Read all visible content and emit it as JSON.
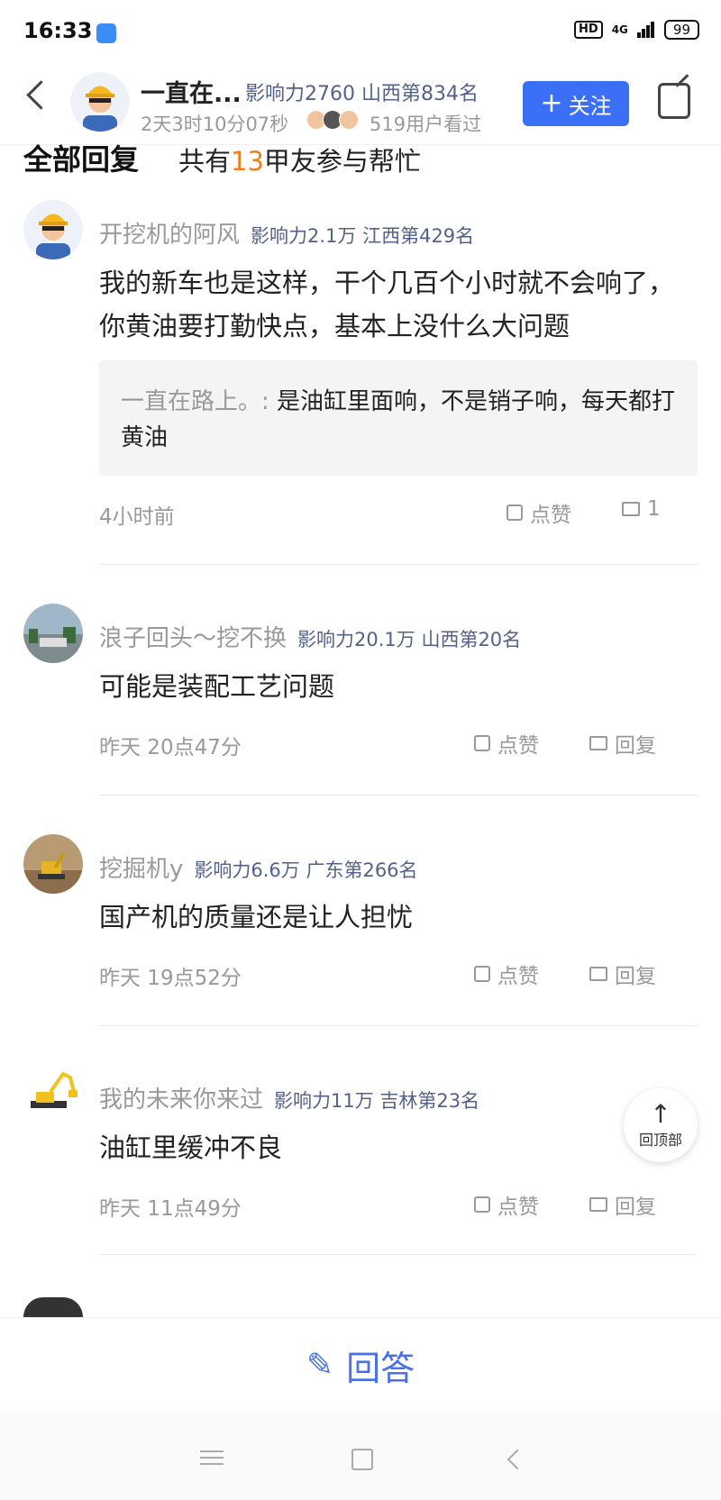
{
  "status_bar": {
    "time": "16:33",
    "hd": "HD",
    "network": "4G",
    "battery": "99"
  },
  "header": {
    "user_name": "一直在...",
    "user_info": "影响力2760 山西第834名",
    "timer": "2天3时10分07秒",
    "viewers": "519用户看过",
    "follow_label": "关注",
    "follow_color": "#3b6ff5"
  },
  "section": {
    "title": "全部回复",
    "sub_prefix": "共有",
    "count": "13",
    "sub_suffix": "甲友参与帮忙"
  },
  "replies": [
    {
      "name": "开挖机的阿风",
      "info": "影响力2.1万 江西第429名",
      "body": "我的新车也是这样，干个几百个小时就不会响了，你黄油要打勤快点，基本上没什么大问题",
      "quote_name": "一直在路上。:",
      "quote_text": "是油缸里面响，不是销子响，每天都打黄油",
      "time": "4小时前",
      "like_label": "点赞",
      "comment_label": "1"
    },
    {
      "name": "浪子回头～挖不换",
      "info": "影响力20.1万 山西第20名",
      "body": "可能是装配工艺问题",
      "time": "昨天 20点47分",
      "like_label": "点赞",
      "comment_label": "回复"
    },
    {
      "name": "挖掘机y",
      "info": "影响力6.6万 广东第266名",
      "body": "国产机的质量还是让人担忧",
      "time": "昨天 19点52分",
      "like_label": "点赞",
      "comment_label": "回复"
    },
    {
      "name": "我的未来你来过",
      "info": "影响力11万 吉林第23名",
      "body": "油缸里缓冲不良",
      "time": "昨天 11点49分",
      "like_label": "点赞",
      "comment_label": "回复"
    }
  ],
  "back_to_top": "回顶部",
  "answer_label": "回答",
  "accent_color": "#4a72e6"
}
